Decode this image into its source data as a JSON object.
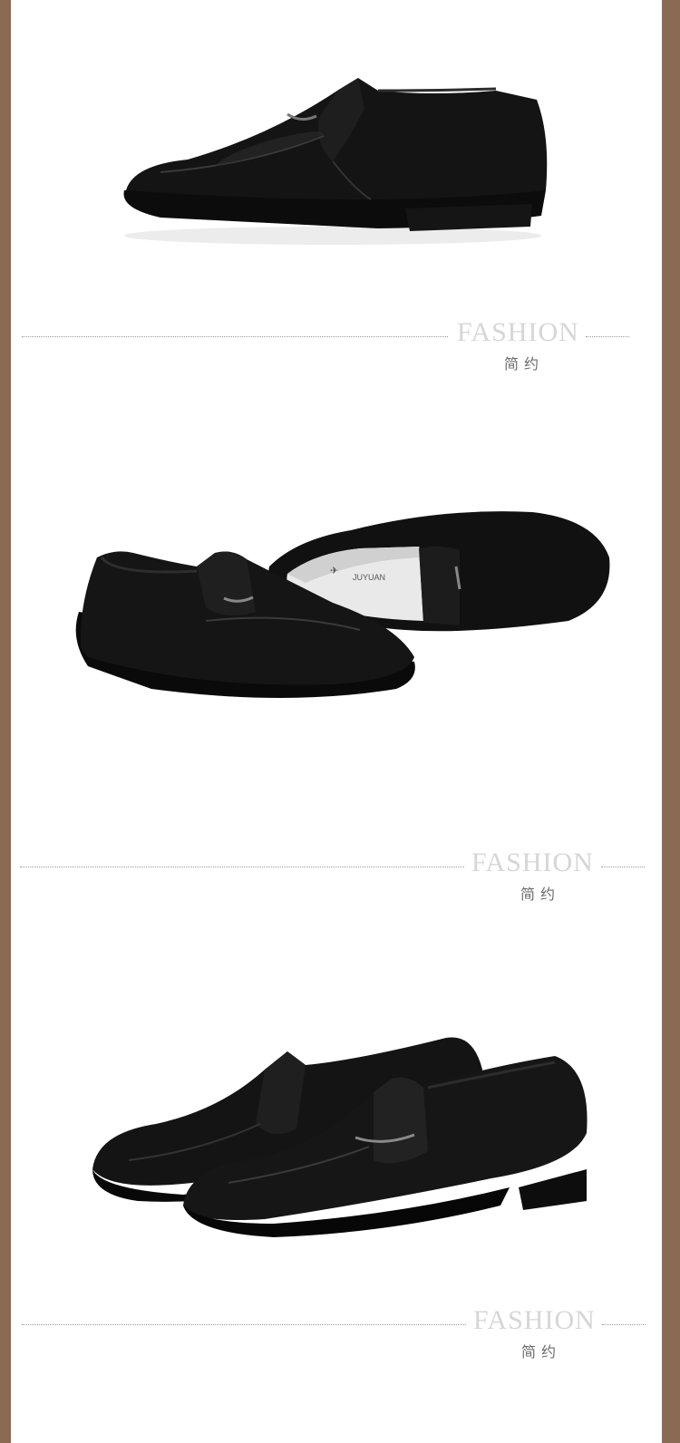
{
  "sections": [
    {
      "heading": "FASHION",
      "subheading": "简约"
    },
    {
      "heading": "FASHION",
      "subheading": "简约"
    },
    {
      "heading": "FASHION",
      "subheading": "简约"
    }
  ],
  "insole_brand": {
    "latin": "JUYUAN"
  },
  "colors": {
    "border": "#8a6a52",
    "background": "#ffffff",
    "heading": "#d6d6d6",
    "leather": "#101010"
  }
}
